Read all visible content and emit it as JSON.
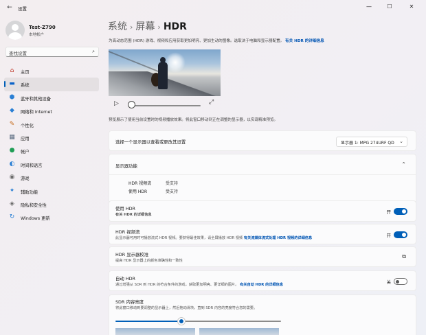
{
  "window": {
    "title": "设置",
    "back_icon": "back-arrow-icon",
    "min_glyph": "—",
    "max_glyph": "☐",
    "close_glyph": "✕"
  },
  "profile": {
    "name": "Test-Z790",
    "account_type": "本地帐户"
  },
  "search": {
    "placeholder": "查找设置"
  },
  "sidebar": {
    "items": [
      {
        "label": "主页",
        "icon": "home-icon",
        "glyph": "⌂",
        "color": "#c0392b"
      },
      {
        "label": "系统",
        "icon": "system-icon",
        "glyph": "▬",
        "color": "#0a63c9",
        "active": true
      },
      {
        "label": "蓝牙和其他设备",
        "icon": "bluetooth-icon",
        "glyph": "⬢",
        "color": "#2a7fd4"
      },
      {
        "label": "网络和 Internet",
        "icon": "wifi-icon",
        "glyph": "◆",
        "color": "#2a7fd4"
      },
      {
        "label": "个性化",
        "icon": "brush-icon",
        "glyph": "✎",
        "color": "#c56a1a"
      },
      {
        "label": "应用",
        "icon": "apps-icon",
        "glyph": "▦",
        "color": "#5a6b80"
      },
      {
        "label": "帐户",
        "icon": "account-icon",
        "glyph": "●",
        "color": "#1f9d55"
      },
      {
        "label": "时间和语言",
        "icon": "globe-icon",
        "glyph": "◐",
        "color": "#2a7fd4"
      },
      {
        "label": "游戏",
        "icon": "gamepad-icon",
        "glyph": "◉",
        "color": "#6b6b6b"
      },
      {
        "label": "辅助功能",
        "icon": "accessibility-icon",
        "glyph": "✦",
        "color": "#2a7fd4"
      },
      {
        "label": "隐私和安全性",
        "icon": "shield-icon",
        "glyph": "◈",
        "color": "#6b6b6b"
      },
      {
        "label": "Windows 更新",
        "icon": "update-icon",
        "glyph": "↻",
        "color": "#2a7fd4"
      }
    ]
  },
  "breadcrumb": {
    "part1": "系统",
    "part2": "屏幕",
    "current": "HDR",
    "separator": "›"
  },
  "description": {
    "text": "为高动态范围 (HDR) 游戏、视频和应用获取更加明亮、更加生动的图像。选取决于电脑和显示器配置。",
    "link": "有关 HDR 的详细信息"
  },
  "player": {
    "play_icon": "play-icon",
    "expand_icon": "expand-icon",
    "play_glyph": "▷",
    "expand_glyph": "⤢",
    "progress": 0
  },
  "preview_note": "预览展示了使用当前设置时的视频播放效果。将此窗口移动到正在调整的显示器，以实现精准预览。",
  "display_select": {
    "label": "选择一个显示器以查看或更改其设置",
    "value": "显示器 1: MPG 274URF QD",
    "chevron": "⌄"
  },
  "capabilities": {
    "title": "显示器功能",
    "chevron": "⌃",
    "rows": [
      {
        "key": "HDR 视频流",
        "value": "受支持"
      },
      {
        "key": "使用 HDR",
        "value": "受支持"
      }
    ]
  },
  "use_hdr": {
    "title": "使用 HDR",
    "link": "有关 HDR 的详细信息",
    "state_label": "开",
    "on": true
  },
  "hdr_video": {
    "title": "HDR 视频流",
    "subtitle": "此显示器可用时可播放流式 HDR 视频。要获得最佳效果，请全屏播放 HDR 视频",
    "link": "有关流媒体流式处理 HDR 视频的详细信息",
    "state_label": "开",
    "on": true
  },
  "calibration": {
    "title": "HDR 显示器校准",
    "subtitle": "提高 HDR 显示器上的颜色准确性和一致性",
    "icon": "external-link-icon",
    "glyph": "⧉"
  },
  "auto_hdr": {
    "title": "自动 HDR",
    "subtitle": "通过增强从 SDR 到 HDR 的符合条件的游戏，获取更加明亮、更详细的图片。",
    "link": "有关自动 HDR 的详细信息",
    "state_label": "关",
    "on": false
  },
  "sdr": {
    "title": "SDR 内容亮度",
    "subtitle": "将此窗口移动到要调整的显示器上，然后拖动滑块，直到 SDR 内容的亮度符合您的需要。",
    "level": 0.4
  },
  "colors": {
    "accent": "#005fb8",
    "link": "#0055b3"
  }
}
